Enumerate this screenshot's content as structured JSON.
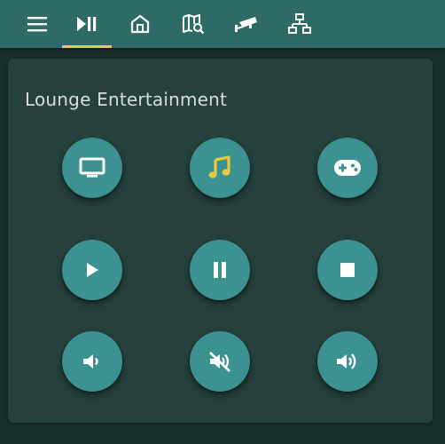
{
  "card": {
    "title": "Lounge Entertainment"
  },
  "colors": {
    "header": "#2e6b67",
    "background": "#182e2c",
    "card": "#26403d",
    "button": "#3c9291",
    "icon": "#ffffff",
    "accent": "#e8c93f"
  },
  "nav": {
    "tabs": [
      {
        "icon": "media-play-pause-icon",
        "active": true
      },
      {
        "icon": "home-icon",
        "active": false
      },
      {
        "icon": "map-search-icon",
        "active": false
      },
      {
        "icon": "security-camera-icon",
        "active": false
      },
      {
        "icon": "network-icon",
        "active": false
      }
    ]
  },
  "buttons": [
    {
      "icon": "tv-icon"
    },
    {
      "icon": "music-note-icon",
      "active": true
    },
    {
      "icon": "gamepad-icon"
    },
    {
      "icon": "play-icon"
    },
    {
      "icon": "pause-icon"
    },
    {
      "icon": "stop-icon"
    },
    {
      "icon": "volume-down-icon"
    },
    {
      "icon": "volume-mute-icon"
    },
    {
      "icon": "volume-up-icon"
    }
  ]
}
